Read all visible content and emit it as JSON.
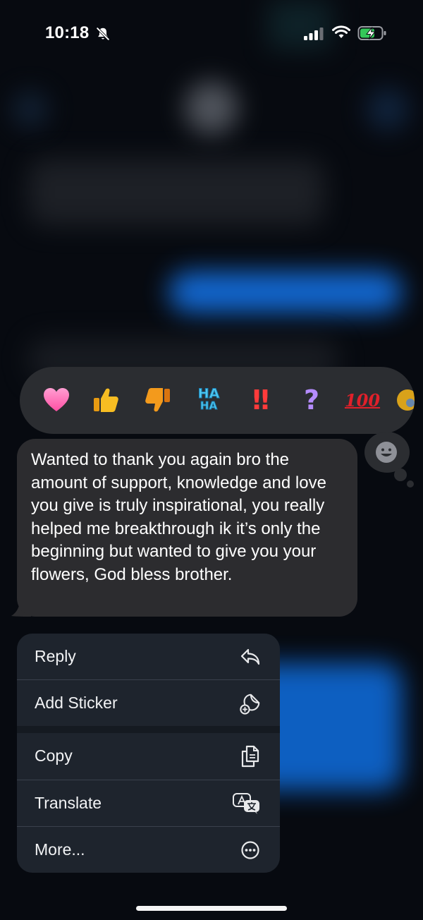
{
  "status_bar": {
    "time": "10:18",
    "icons": [
      "bell-slash-icon",
      "cellular-signal-icon",
      "wifi-icon",
      "battery-charging-icon"
    ],
    "battery_color": "#34c759"
  },
  "reactions": {
    "items": [
      {
        "name": "heart",
        "color": "#ff6fb5"
      },
      {
        "name": "thumbs-up",
        "color": "#f6b81c"
      },
      {
        "name": "thumbs-down",
        "color": "#f29a1c"
      },
      {
        "name": "haha",
        "label_top": "HA",
        "label_bottom": "HA",
        "color": "#4fc7ee"
      },
      {
        "name": "double-exclamation",
        "label": "‼",
        "color": "#ff3b3b"
      },
      {
        "name": "question",
        "label": "?",
        "color": "#b58cff"
      },
      {
        "name": "hundred",
        "label": "100",
        "color": "#e0202a"
      }
    ],
    "add_reaction_icon": "smiley-plus-icon"
  },
  "message": {
    "text": "Wanted to thank you again bro the amount of support, knowledge and love you give is truly inspirational, you really helped me breakthrough ik it’s only the beginning but wanted to give you your flowers, God bless brother."
  },
  "menu": {
    "items": [
      {
        "label": "Reply",
        "icon": "reply-arrow-icon"
      },
      {
        "label": "Add Sticker",
        "icon": "add-sticker-icon"
      },
      {
        "label": "Copy",
        "icon": "copy-icon"
      },
      {
        "label": "Translate",
        "icon": "translate-icon"
      },
      {
        "label": "More...",
        "icon": "more-ellipsis-icon"
      }
    ]
  },
  "colors": {
    "accent_blue": "#1578f2",
    "bubble_gray": "#2c2c2f"
  }
}
